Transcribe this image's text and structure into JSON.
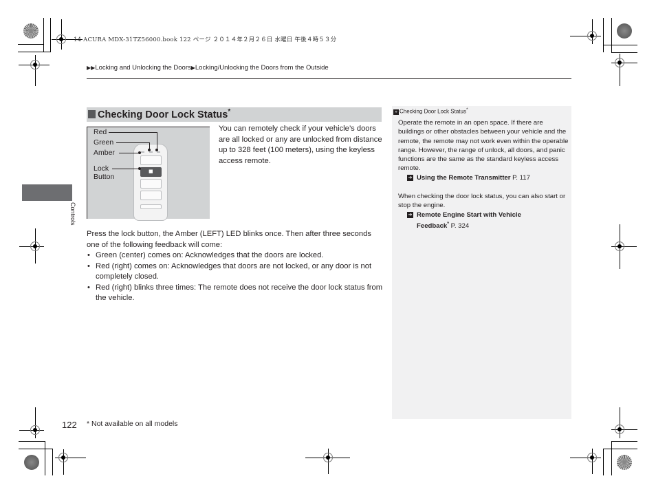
{
  "print_header": "14 ACURA MDX-31TZ56000.book  122 ページ  ２０１４年２月２６日  水曜日  午後４時５３分",
  "breadcrumb": {
    "arrows": "▶▶",
    "item1": "Locking and Unlocking the Doors",
    "separator": "▶",
    "item2": "Locking/Unlocking the Doors from the Outside"
  },
  "side_tab": {
    "label": "Controls"
  },
  "section": {
    "title": "Checking Door Lock Status",
    "asterisk": "*"
  },
  "figure": {
    "labels": {
      "red": "Red",
      "green": "Green",
      "amber": "Amber",
      "lock_line1": "Lock",
      "lock_line2": "Button"
    },
    "lock_glyph": "🔒"
  },
  "intro_text": "You can remotely check if your vehicle’s doors are all locked or any are unlocked from distance up to 328 feet (100 meters), using the keyless access remote.",
  "instructions": "Press the lock button, the Amber (LEFT) LED blinks once. Then after three seconds one of the following feedback will come:",
  "bullets": [
    "Green (center) comes on: Acknowledges that the doors are locked.",
    "Red (right) comes on: Acknowledges that doors are not locked, or any door is not completely closed.",
    "Red (right) blinks three times: The remote does not receive the door lock status from the vehicle."
  ],
  "bullet_glyph": "•",
  "sidebar": {
    "heading": "Checking Door Lock Status",
    "heading_icon": "»",
    "heading_asterisk": "*",
    "para1": "Operate the remote in an open space. If there are buildings or other obstacles between your vehicle and the remote, the remote may not work even within the operable range. However, the range of unlock, all doors, and panic functions are the same as the standard keyless access remote.",
    "ref1": {
      "icon": "➔",
      "title": "Using the Remote Transmitter",
      "page": " P. 117"
    },
    "para2": "When checking the door lock status, you can also start or stop the engine.",
    "ref2": {
      "icon": "➔",
      "title_line1": "Remote Engine Start with Vehicle",
      "title_line2": "Feedback",
      "asterisk": "*",
      "page": " P. 324"
    }
  },
  "footer": {
    "page_number": "122",
    "footnote": "* Not available on all models"
  }
}
